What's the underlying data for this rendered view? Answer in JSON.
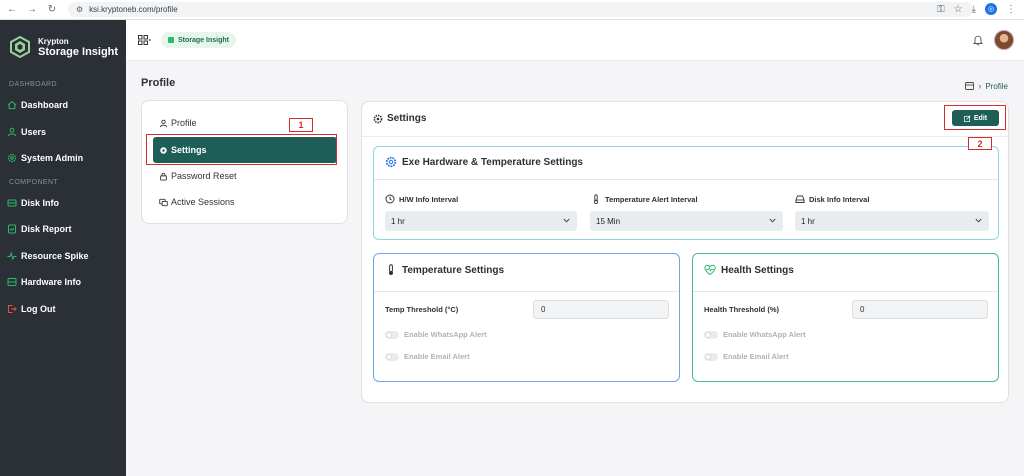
{
  "browser": {
    "url": "ksi.kryptoneb.com/profile",
    "profile_initial": "◎"
  },
  "brand": {
    "line1": "Krypton",
    "line2": "Storage Insight"
  },
  "sidebar": {
    "sections": [
      {
        "label": "DASHBOARD"
      },
      {
        "label": "COMPONENT"
      }
    ],
    "items": [
      {
        "label": "Dashboard"
      },
      {
        "label": "Users"
      },
      {
        "label": "System Admin"
      },
      {
        "label": "Disk Info"
      },
      {
        "label": "Disk Report"
      },
      {
        "label": "Resource Spike"
      },
      {
        "label": "Hardware Info"
      },
      {
        "label": "Log Out"
      }
    ]
  },
  "topbar": {
    "pill_label": "Storage Insight"
  },
  "page": {
    "title": "Profile",
    "breadcrumb_current": "Profile"
  },
  "profile_menu": {
    "items": [
      {
        "label": "Profile"
      },
      {
        "label": "Settings"
      },
      {
        "label": "Password Reset"
      },
      {
        "label": "Active Sessions"
      }
    ],
    "active_index": 1
  },
  "annotations": [
    {
      "number": "1"
    },
    {
      "number": "2"
    }
  ],
  "settings": {
    "title": "Settings",
    "edit_label": "Edit",
    "hardware": {
      "title": "Exe Hardware & Temperature Settings",
      "hw_interval": {
        "label": "H/W Info Interval",
        "value": "1 hr"
      },
      "temp_interval": {
        "label": "Temperature Alert Interval",
        "value": "15 Min"
      },
      "disk_interval": {
        "label": "Disk Info Interval",
        "value": "1 hr"
      }
    },
    "temperature": {
      "title": "Temperature Settings",
      "threshold_label": "Temp Threshold (°C)",
      "threshold_value": "0",
      "whatsapp_label": "Enable WhatsApp Alert",
      "email_label": "Enable Email Alert"
    },
    "health": {
      "title": "Health Settings",
      "threshold_label": "Health Threshold (%)",
      "threshold_value": "0",
      "whatsapp_label": "Enable WhatsApp Alert",
      "email_label": "Enable Email Alert"
    }
  },
  "colors": {
    "sidebar_bg": "#2b3036",
    "accent": "#1e5e56",
    "sidebar_icon": "#2fb86a",
    "annotation": "#d32f2f",
    "card_border": "#8fd6df"
  }
}
